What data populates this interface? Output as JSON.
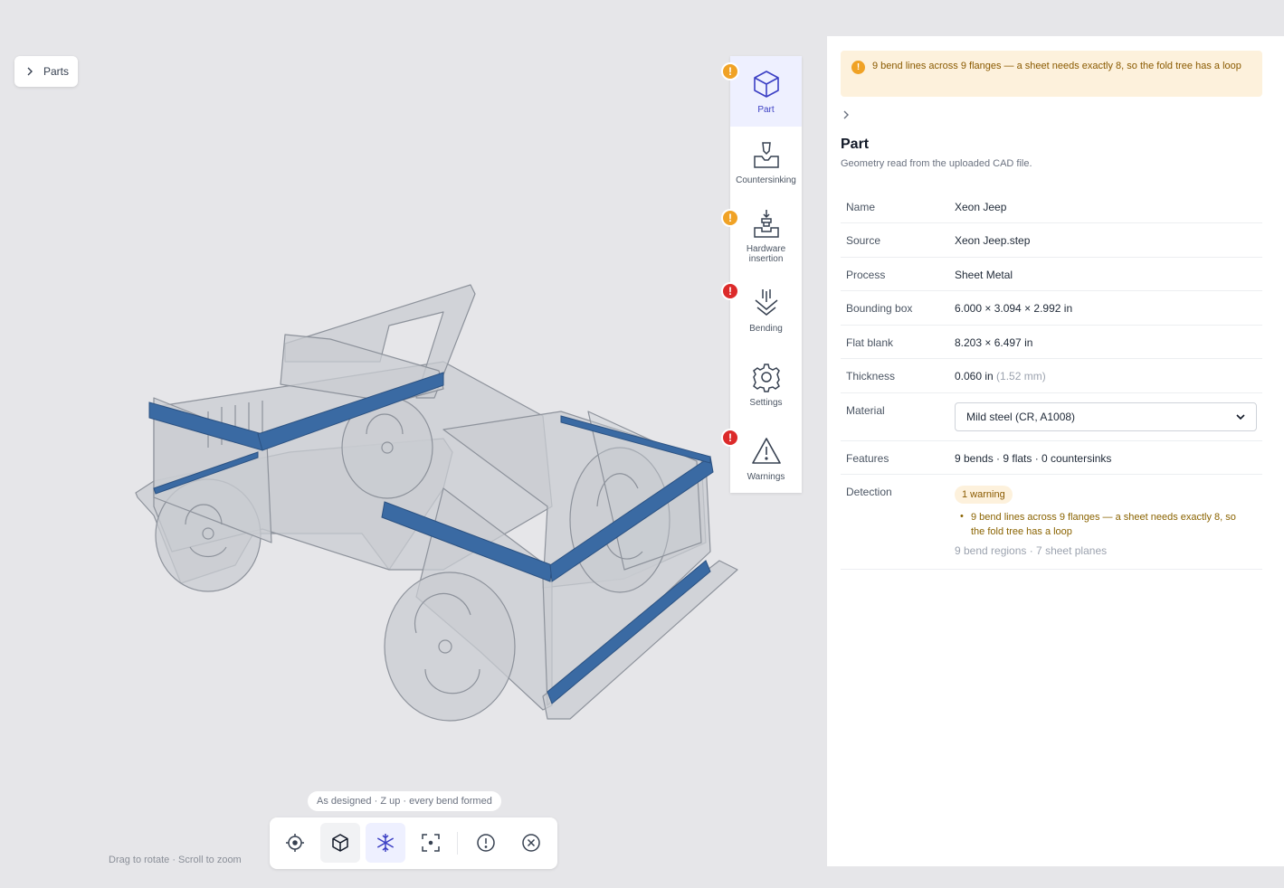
{
  "viewer": {
    "parts_label": "Parts",
    "caption": "As designed · Z up · every bend formed",
    "hint": "Drag to rotate · Scroll to zoom",
    "toolbar": [
      {
        "name": "target-icon"
      },
      {
        "name": "cube-icon"
      },
      {
        "name": "snowflake-icon"
      },
      {
        "name": "fit-view-icon"
      },
      {
        "name": "warning-circle-icon"
      },
      {
        "name": "close-circle-icon"
      }
    ]
  },
  "rail": {
    "items": [
      {
        "label": "Part",
        "icon": "cube-icon",
        "active": true,
        "badge": "warning"
      },
      {
        "label": "Countersinking",
        "icon": "countersink-icon",
        "active": false,
        "badge": null
      },
      {
        "label_line1": "Hardware",
        "label_line2": "insertion",
        "icon": "hardware-insertion-icon",
        "active": false,
        "badge": "warning"
      },
      {
        "label": "Bending",
        "icon": "bending-icon",
        "active": false,
        "badge": "error"
      },
      {
        "label": "Settings",
        "icon": "gear-icon",
        "active": false,
        "badge": null
      },
      {
        "label": "Warnings",
        "icon": "warning-triangle-icon",
        "active": false,
        "badge": "error"
      }
    ],
    "badge_text": "!"
  },
  "panel": {
    "alert": "9 bend lines across 9 flanges — a sheet needs exactly 8, so the fold tree has a loop",
    "title": "Part",
    "subtitle": "Geometry read from the uploaded CAD file.",
    "props": {
      "name_k": "Name",
      "name_v": "Xeon Jeep",
      "source_k": "Source",
      "source_v": "Xeon Jeep.step",
      "process_k": "Process",
      "process_v": "Sheet Metal",
      "bbox_k": "Bounding box",
      "bbox_v": "6.000 × 3.094 × 2.992 in",
      "flat_k": "Flat blank",
      "flat_v": "8.203 × 6.497 in",
      "thick_k": "Thickness",
      "thick_v": "0.060 in",
      "thick_mm": "(1.52 mm)",
      "material_k": "Material",
      "material_v": "Mild steel (CR, A1008)",
      "features_k": "Features",
      "features_v": "9 bends · 9 flats · 0 countersinks",
      "detection_k": "Detection",
      "detection_pill": "1 warning",
      "detection_line1": "9 bend lines across 9 flanges — a sheet needs exactly 8, so",
      "detection_line2": "the fold tree has a loop",
      "detection_meta": "9 bend regions · 7 sheet planes"
    }
  },
  "colors": {
    "accent": "#3b3fc4",
    "bend_blue": "#3a6aa3",
    "warning": "#f0a225",
    "error": "#dc2a2a",
    "alert_bg": "#fdf1dc"
  }
}
